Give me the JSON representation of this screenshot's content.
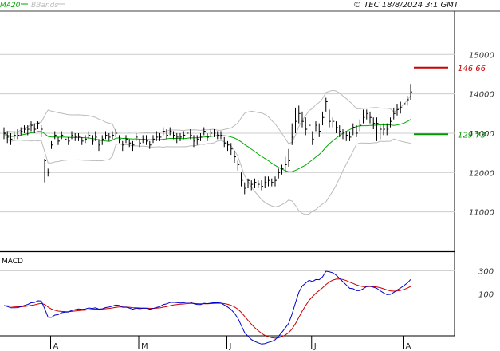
{
  "header": {
    "copyright": "© TEC 18/8/2024 3:1 GMT",
    "legend": [
      {
        "label": "MA20",
        "color": "#00aa00"
      },
      {
        "label": "BBands",
        "color": "#bbbbbb"
      }
    ]
  },
  "colors": {
    "price": "#000000",
    "ma20": "#00aa00",
    "bbands": "#bbbbbb",
    "grid": "#cccccc",
    "marker_high": "#cc0000",
    "marker_low": "#009900",
    "macd": "#0000cc",
    "signal": "#cc0000"
  },
  "chart_data": [
    {
      "type": "ohlc",
      "legend": [
        "MA20",
        "BBands"
      ],
      "ylim": [
        10000,
        16100
      ],
      "yticks": [
        11000,
        12000,
        13000,
        14000,
        15000
      ],
      "ytick_labels": [
        "11000",
        "12000",
        "13000",
        "14000",
        "15000"
      ],
      "xtick_labels": [
        "A",
        "M",
        "J",
        "J",
        "A"
      ],
      "xtick_index": [
        14,
        40,
        66,
        91,
        118
      ],
      "close": [
        13000,
        12900,
        12850,
        12950,
        12950,
        13050,
        13100,
        13100,
        13200,
        13100,
        13250,
        13100,
        12300,
        12000,
        12700,
        12950,
        12800,
        12950,
        12850,
        12800,
        12950,
        12900,
        12900,
        12800,
        12850,
        12950,
        12800,
        12900,
        12700,
        12850,
        12950,
        12900,
        12950,
        13000,
        12850,
        12700,
        12850,
        12750,
        12700,
        12900,
        12750,
        12850,
        12800,
        12700,
        12850,
        12900,
        12900,
        13050,
        12950,
        13050,
        12950,
        12900,
        12900,
        12950,
        13000,
        12950,
        12800,
        12850,
        12900,
        13050,
        12900,
        13000,
        13000,
        12950,
        12950,
        12750,
        12700,
        12600,
        12400,
        12200,
        11800,
        11600,
        11800,
        11700,
        11750,
        11700,
        11650,
        11750,
        11800,
        11750,
        11800,
        12000,
        12100,
        12200,
        12300,
        12900,
        13300,
        13500,
        13300,
        13100,
        13200,
        12850,
        13200,
        13050,
        13400,
        13800,
        13300,
        13300,
        13150,
        13050,
        13000,
        12950,
        12900,
        13150,
        13000,
        13200,
        13400,
        13500,
        13400,
        13250,
        13250,
        13100,
        13100,
        13100,
        13300,
        13500,
        13600,
        13650,
        13750,
        13850,
        14050
      ],
      "high": [
        13150,
        13050,
        13000,
        13050,
        13100,
        13150,
        13200,
        13200,
        13300,
        13250,
        13300,
        13200,
        12350,
        12100,
        12800,
        13050,
        12900,
        13050,
        12950,
        12900,
        13050,
        13000,
        13000,
        12900,
        12950,
        13050,
        12950,
        13050,
        12850,
        12950,
        13050,
        13000,
        13050,
        13100,
        12950,
        12800,
        12950,
        12850,
        12800,
        13000,
        12850,
        12950,
        12950,
        12800,
        12950,
        13050,
        13000,
        13150,
        13100,
        13150,
        13050,
        13000,
        13000,
        13050,
        13100,
        13100,
        12950,
        12950,
        13000,
        13150,
        13000,
        13100,
        13100,
        13050,
        13050,
        12900,
        12800,
        12750,
        12550,
        12300,
        12000,
        11750,
        11850,
        11800,
        11850,
        11800,
        11800,
        11900,
        11900,
        11850,
        11900,
        12100,
        12200,
        12400,
        12600,
        13250,
        13650,
        13700,
        13550,
        13400,
        13350,
        13050,
        13300,
        13250,
        13550,
        13900,
        13600,
        13400,
        13300,
        13200,
        13100,
        13050,
        13050,
        13250,
        13200,
        13350,
        13600,
        13600,
        13550,
        13400,
        13400,
        13200,
        13250,
        13250,
        13400,
        13650,
        13750,
        13800,
        13900,
        13950,
        14250
      ],
      "low": [
        12850,
        12750,
        12700,
        12850,
        12850,
        12950,
        13000,
        12950,
        13050,
        13000,
        13100,
        12900,
        11750,
        11900,
        12600,
        12850,
        12700,
        12850,
        12750,
        12700,
        12850,
        12800,
        12800,
        12700,
        12750,
        12850,
        12700,
        12800,
        12550,
        12700,
        12850,
        12800,
        12850,
        12900,
        12750,
        12550,
        12750,
        12650,
        12550,
        12800,
        12650,
        12750,
        12700,
        12600,
        12750,
        12800,
        12800,
        12950,
        12850,
        12950,
        12850,
        12750,
        12800,
        12850,
        12900,
        12850,
        12650,
        12700,
        12800,
        12950,
        12800,
        12900,
        12900,
        12850,
        12850,
        12650,
        12550,
        12450,
        12250,
        12050,
        11650,
        11450,
        11600,
        11550,
        11600,
        11600,
        11550,
        11600,
        11650,
        11650,
        11650,
        11850,
        11950,
        12000,
        12150,
        12700,
        13000,
        13250,
        13150,
        12950,
        13050,
        12700,
        13050,
        12900,
        13200,
        13550,
        13150,
        13150,
        13000,
        12900,
        12850,
        12800,
        12800,
        12950,
        12900,
        13050,
        13250,
        13350,
        13250,
        13100,
        12800,
        12850,
        12950,
        12950,
        13150,
        13350,
        13450,
        13500,
        13600,
        13700,
        13850
      ],
      "markers": [
        {
          "label": "146 66",
          "value": 14666,
          "color": "#cc0000"
        },
        {
          "label": "129.73",
          "value": 12973,
          "color": "#009900"
        }
      ]
    },
    {
      "type": "line",
      "title": "MACD",
      "ylim": [
        -260,
        460
      ],
      "yticks": [
        100,
        300
      ],
      "ytick_labels": [
        "100",
        "300"
      ],
      "x_start_index": 0
    }
  ]
}
